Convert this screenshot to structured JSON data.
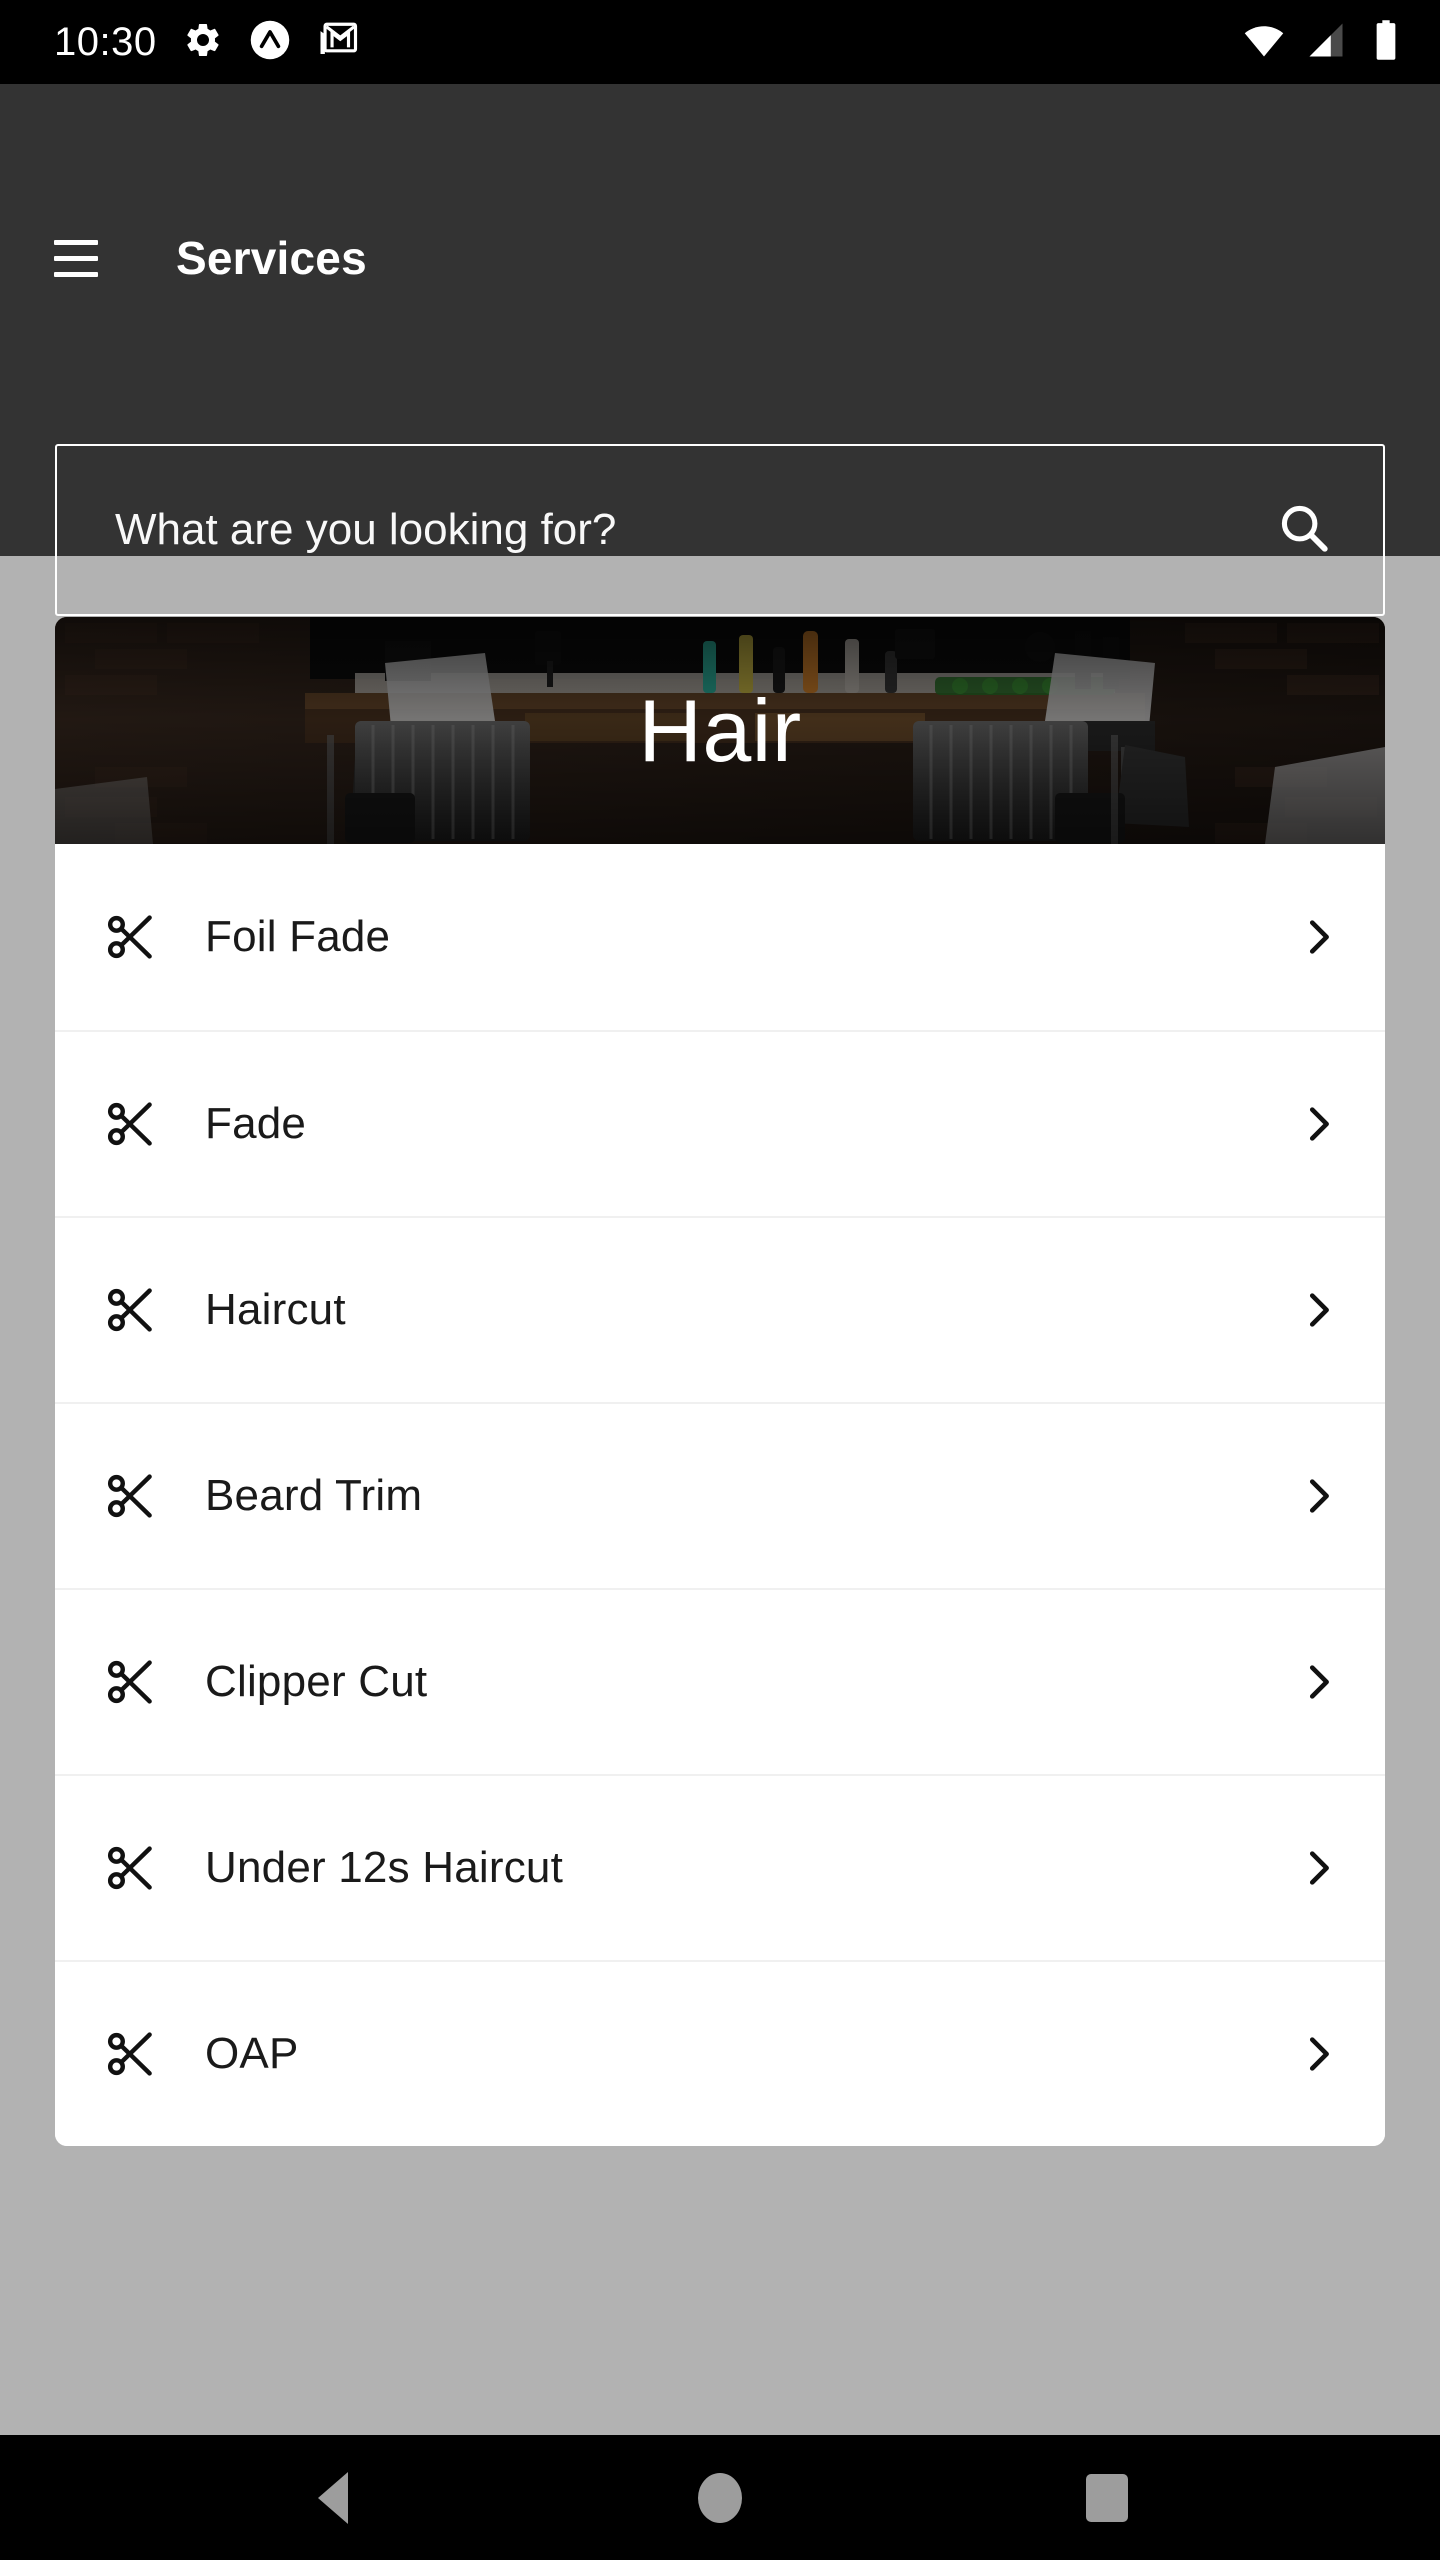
{
  "status_bar": {
    "time": "10:30",
    "left_icons": [
      "gear-icon",
      "circle-caret-logo-icon",
      "gmail-icon"
    ],
    "right_icons": [
      "wifi-icon",
      "cellular-signal-icon",
      "battery-icon"
    ]
  },
  "app_bar": {
    "menu_icon": "hamburger-menu-icon",
    "title": "Services"
  },
  "search": {
    "placeholder": "What are you looking for?",
    "value": "",
    "icon": "search-icon"
  },
  "hero": {
    "title": "Hair",
    "image_alt": "barbershop-interior"
  },
  "services": {
    "item_icon": "scissors-icon",
    "chevron_icon": "chevron-right-icon",
    "items": [
      {
        "label": "Foil Fade"
      },
      {
        "label": "Fade"
      },
      {
        "label": "Haircut"
      },
      {
        "label": "Beard Trim"
      },
      {
        "label": "Clipper Cut"
      },
      {
        "label": "Under 12s Haircut"
      },
      {
        "label": "OAP"
      }
    ]
  },
  "nav_bar": {
    "back_label": "Back",
    "home_label": "Home",
    "recents_label": "Recents"
  },
  "colors": {
    "app_bar": "#333333",
    "page_background": "#b2b2b2",
    "card": "#ffffff",
    "text_primary": "#1a1a1a",
    "on_dark": "#ffffff",
    "divider": "#f0f0f0",
    "nav_icon": "#9d9d9d"
  }
}
